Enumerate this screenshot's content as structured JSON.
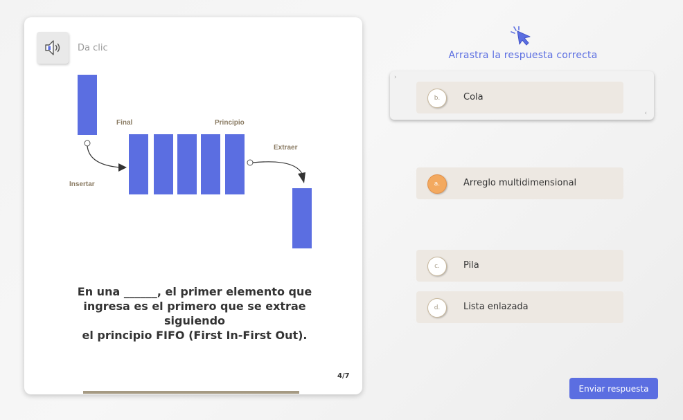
{
  "audio": {
    "hint": "Da clic"
  },
  "diagram": {
    "label_final": "Final",
    "label_principio": "Principio",
    "label_extraer": "Extraer",
    "label_insertar": "Insertar"
  },
  "question": {
    "line1": "En una ______, el primer elemento que",
    "line2": "ingresa es el primero que se extrae siguiendo",
    "line3": "el principio FIFO (First In-First Out)."
  },
  "pagination": {
    "current": "4/7"
  },
  "instructions": "Arrastra la respuesta correcta",
  "drop_zone": {
    "chevron_left": "›",
    "chevron_right": "‹",
    "placed": {
      "letter": "b.",
      "label": "Cola"
    }
  },
  "options": [
    {
      "letter": "a.",
      "label": "Arreglo multidimensional",
      "highlighted": true
    },
    {
      "letter": "c.",
      "label": "Pila",
      "highlighted": false
    },
    {
      "letter": "d.",
      "label": "Lista enlazada",
      "highlighted": false
    }
  ],
  "submit_label": "Enviar respuesta",
  "colors": {
    "accent": "#5b6ee1",
    "bar_fill": "#5b6ee1",
    "label_color": "#8a7b63",
    "option_bg": "#ede8e2",
    "badge_selected": "#f3a95f",
    "progress": "#a59a83"
  }
}
